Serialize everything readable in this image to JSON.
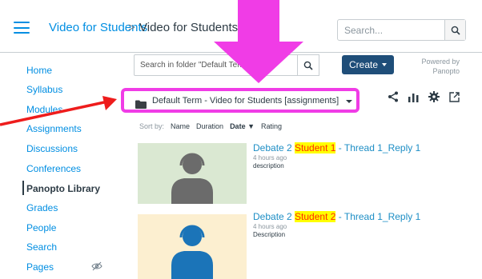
{
  "header": {
    "menu_icon": "hamburger-icon",
    "breadcrumb_course": "Video for Students",
    "breadcrumb_separator": ">",
    "breadcrumb_page": "Video for Students",
    "search_placeholder": "Search...",
    "search_icon": "search-icon"
  },
  "sidebar": {
    "items": [
      {
        "label": "Home"
      },
      {
        "label": "Syllabus"
      },
      {
        "label": "Modules"
      },
      {
        "label": "Assignments"
      },
      {
        "label": "Discussions"
      },
      {
        "label": "Conferences"
      },
      {
        "label": "Panopto Library",
        "active": true
      },
      {
        "label": "Grades"
      },
      {
        "label": "People"
      },
      {
        "label": "Search"
      },
      {
        "label": "Pages",
        "hidden_icon": "eye-slash-icon"
      }
    ]
  },
  "panopto": {
    "folder_search_placeholder": "Search in folder \"Default Term - ...",
    "create_label": "Create",
    "powered_by_line1": "Powered by",
    "powered_by_line2": "Panopto",
    "folder_name": "Default Term - Video for Students [assignments]",
    "tool_icons": [
      "share-icon",
      "stats-icon",
      "settings-icon",
      "open-external-icon"
    ],
    "sort": {
      "label": "Sort by:",
      "options": [
        "Name",
        "Duration",
        "Date ▼",
        "Rating"
      ],
      "selected": "Date ▼"
    },
    "videos": [
      {
        "title_prefix": "Debate 2 ",
        "title_highlight": "Student 1",
        "title_suffix": " - Thread 1_Reply 1",
        "time": "4 hours ago",
        "description": "description",
        "thumb_color": "#dae8d2",
        "avatar_color": "#6b6b6b"
      },
      {
        "title_prefix": "Debate 2 ",
        "title_highlight": "Student 2",
        "title_suffix": " - Thread 1_Reply 1",
        "time": "4 hours ago",
        "description": "Description",
        "thumb_color": "#fcefd0",
        "avatar_color": "#1b74b8"
      }
    ]
  },
  "annotations": {
    "highlight_color": "#f03ce6",
    "arrow_color": "#ee1c1c"
  }
}
